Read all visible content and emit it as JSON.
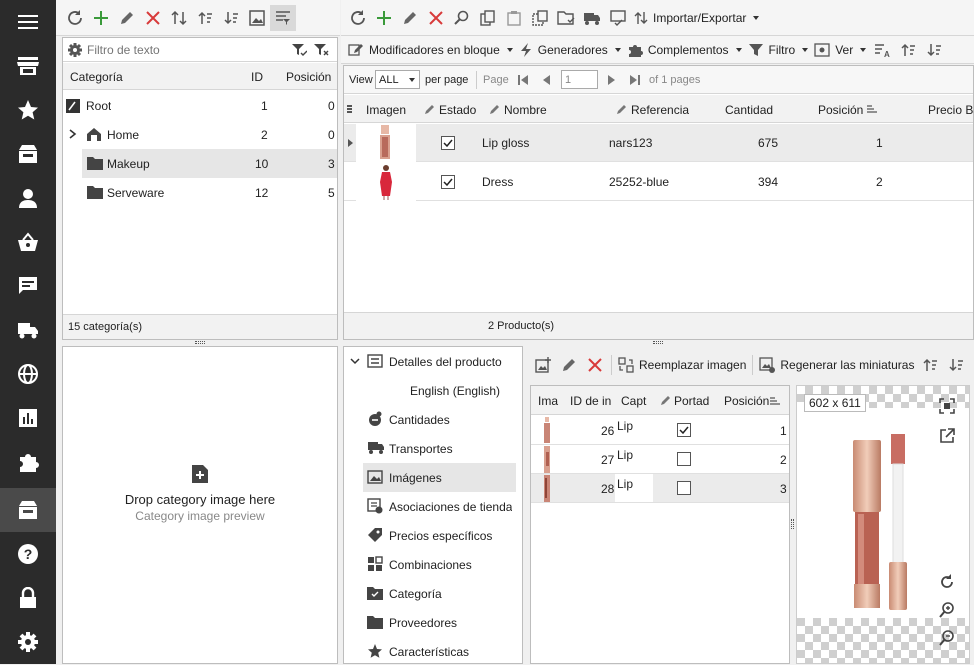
{
  "sidebar": {
    "items": [
      {
        "icon": "menu-icon"
      },
      {
        "icon": "store-icon"
      },
      {
        "icon": "star-icon"
      },
      {
        "icon": "box-icon"
      },
      {
        "icon": "user-icon"
      },
      {
        "icon": "basket-icon"
      },
      {
        "icon": "chat-icon"
      },
      {
        "icon": "truck-icon"
      },
      {
        "icon": "globe-icon"
      },
      {
        "icon": "chart-icon"
      },
      {
        "icon": "puzzle-icon"
      },
      {
        "icon": "catalog-icon"
      },
      {
        "icon": "help-icon"
      },
      {
        "icon": "lock-icon"
      },
      {
        "icon": "gear-icon"
      }
    ]
  },
  "categories": {
    "filter_placeholder": "Filtro de texto",
    "columns": {
      "name": "Categoría",
      "id": "ID",
      "position": "Posición"
    },
    "rows": [
      {
        "name": "Root",
        "id": "1",
        "position": "0"
      },
      {
        "name": "Home",
        "id": "2",
        "position": "0"
      },
      {
        "name": "Makeup",
        "id": "10",
        "position": "3"
      },
      {
        "name": "Serveware",
        "id": "12",
        "position": "5"
      }
    ],
    "footer": "15 categoría(s)"
  },
  "dropzone": {
    "title": "Drop category image here",
    "subtitle": "Category image preview"
  },
  "products": {
    "toolbar": {
      "import_export": "Importar/Exportar",
      "bulk": "Modificadores en bloque",
      "generators": "Generadores",
      "addons": "Complementos",
      "filter": "Filtro",
      "view": "Ver"
    },
    "pager": {
      "view": "View",
      "view_value": "ALL",
      "per_page": "per page",
      "page": "Page",
      "page_value": "1",
      "of_pages": "of 1 pages"
    },
    "columns": {
      "image": "Imagen",
      "status": "Estado",
      "name": "Nombre",
      "reference": "Referencia",
      "quantity": "Cantidad",
      "position": "Posición",
      "price": "Precio Ba"
    },
    "rows": [
      {
        "name": "Lip gloss",
        "reference": "nars123",
        "quantity": "675",
        "position": "1",
        "checked": true
      },
      {
        "name": "Dress",
        "reference": "25252-blue",
        "quantity": "394",
        "position": "2",
        "checked": true
      }
    ],
    "footer": "2 Producto(s)"
  },
  "details": {
    "items": [
      {
        "label": "Detalles del producto",
        "icon": "details-icon"
      },
      {
        "label": "English (English)",
        "icon": ""
      },
      {
        "label": "Cantidades",
        "icon": "quantities-icon"
      },
      {
        "label": "Transportes",
        "icon": "truck-icon"
      },
      {
        "label": "Imágenes",
        "icon": "image-icon"
      },
      {
        "label": "Asociaciones de tienda",
        "icon": "store-assoc-icon"
      },
      {
        "label": "Precios específicos",
        "icon": "tag-icon"
      },
      {
        "label": "Combinaciones",
        "icon": "grid-icon"
      },
      {
        "label": "Categoría",
        "icon": "folder-check-icon"
      },
      {
        "label": "Proveedores",
        "icon": "folder-icon"
      },
      {
        "label": "Características",
        "icon": "star-icon"
      }
    ]
  },
  "images": {
    "toolbar": {
      "replace": "Reemplazar imagen",
      "regenerate": "Regenerar las miniaturas"
    },
    "columns": {
      "image": "Ima",
      "id": "ID de in",
      "caption": "Capt",
      "cover": "Portad",
      "position": "Posición"
    },
    "rows": [
      {
        "id": "26",
        "caption": "Lip",
        "cover": true,
        "position": "1"
      },
      {
        "id": "27",
        "caption": "Lip",
        "cover": false,
        "position": "2"
      },
      {
        "id": "28",
        "caption": "Lip",
        "cover": false,
        "position": "3"
      }
    ],
    "preview_size": "602 x 611"
  }
}
